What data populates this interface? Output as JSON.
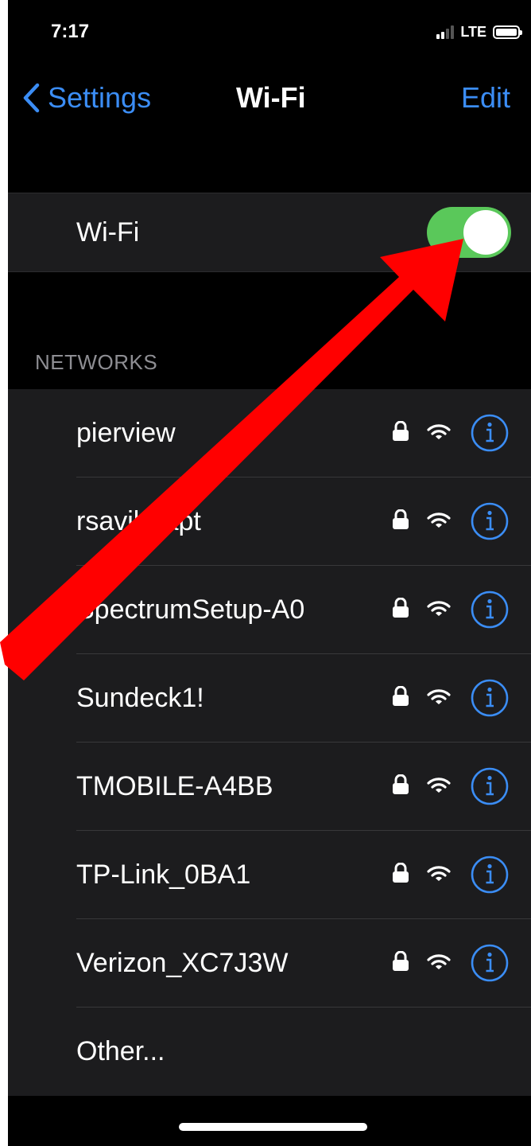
{
  "status_bar": {
    "time": "7:17",
    "carrier": "LTE"
  },
  "nav": {
    "back_label": "Settings",
    "title": "Wi-Fi",
    "edit_label": "Edit"
  },
  "wifi": {
    "label": "Wi-Fi",
    "enabled": true
  },
  "networks": {
    "header": "NETWORKS",
    "items": [
      {
        "name": "pierview"
      },
      {
        "name": "rsavile-apt"
      },
      {
        "name": "SpectrumSetup-A0"
      },
      {
        "name": "Sundeck1!"
      },
      {
        "name": "TMOBILE-A4BB"
      },
      {
        "name": "TP-Link_0BA1"
      },
      {
        "name": "Verizon_XC7J3W"
      }
    ],
    "other_label": "Other..."
  },
  "colors": {
    "accent": "#3b8df5",
    "toggle_on": "#5ac85a",
    "annotation_arrow": "#ff0000"
  },
  "icons": [
    "chevron-left-icon",
    "lock-icon",
    "wifi-icon",
    "info-icon",
    "signal-icon",
    "battery-icon"
  ]
}
